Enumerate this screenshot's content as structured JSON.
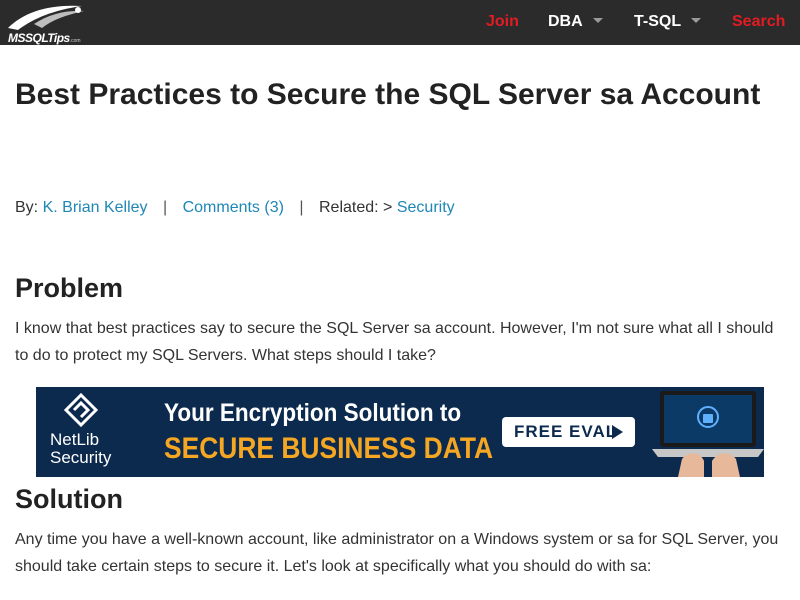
{
  "header": {
    "logo_text": "MSSQLTips",
    "logo_sub": ".com",
    "nav": [
      {
        "label": "Join",
        "color": "#e31b23",
        "dropdown": false
      },
      {
        "label": "DBA",
        "color": "#ffffff",
        "dropdown": true
      },
      {
        "label": "T-SQL",
        "color": "#ffffff",
        "dropdown": true
      },
      {
        "label": "Search",
        "color": "#e31b23",
        "dropdown": false
      }
    ]
  },
  "article": {
    "title": "Best Practices to Secure the SQL Server sa Account",
    "byline": {
      "by_label": "By:",
      "author": "K. Brian Kelley",
      "separator": "|",
      "comments": "Comments (3)",
      "related_label": "Related:",
      "related_arrow": ">",
      "related_link": "Security"
    },
    "problem_heading": "Problem",
    "problem_text": "I know that best practices say to secure the SQL Server sa account. However, I'm not sure what all I should to do to protect my SQL Servers. What steps should I take?",
    "solution_heading": "Solution",
    "solution_text": "Any time you have a well-known account, like administrator on a Windows system or sa for SQL Server, you should take certain steps to secure it. Let's look at specifically what you should do with sa:"
  },
  "ad": {
    "brand_line1": "NetLib",
    "brand_line2": "Security",
    "headline1": "Your Encryption Solution to",
    "headline2": "SECURE BUSINESS DATA",
    "cta": "FREE EVAL",
    "colors": {
      "background": "#0c2a4e",
      "accent": "#f5a623"
    }
  },
  "colors": {
    "link": "#1f86b6",
    "nav_red": "#e31b23",
    "topbar": "#2b2b2b"
  }
}
